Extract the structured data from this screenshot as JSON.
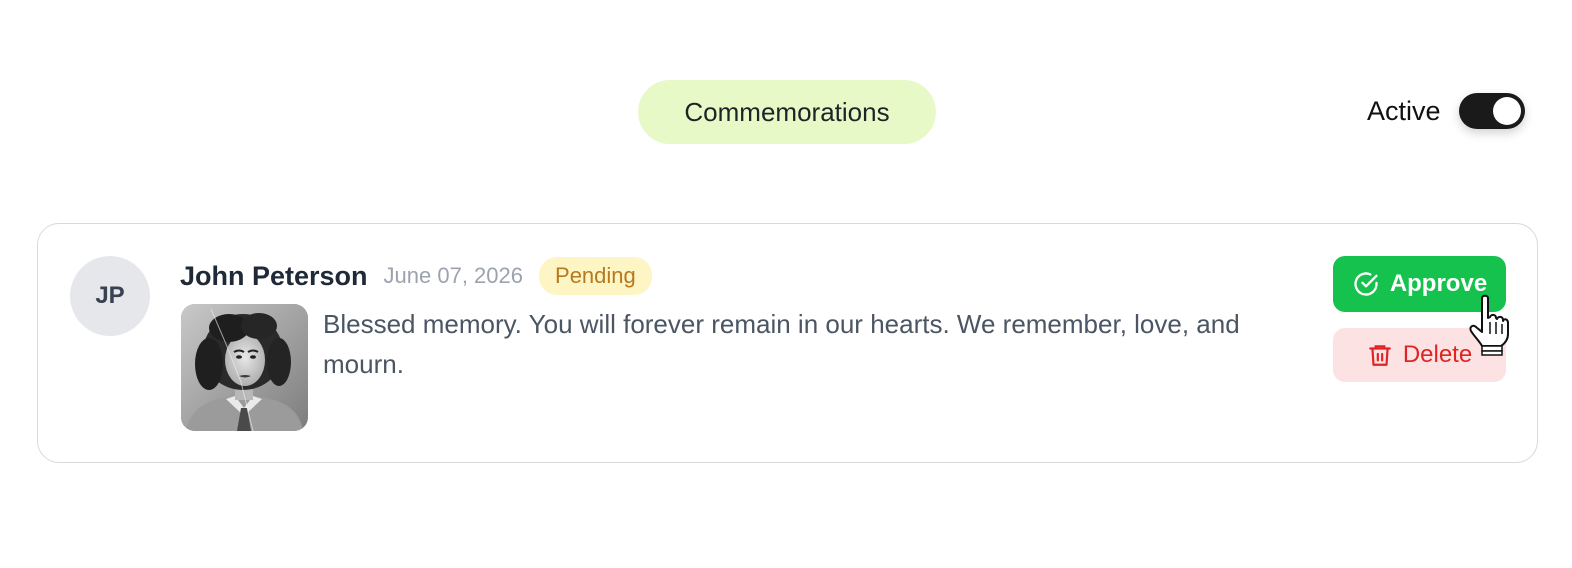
{
  "header": {
    "title": "Commemorations",
    "active_label": "Active",
    "active_on": true
  },
  "card": {
    "avatar_initials": "JP",
    "author": "John Peterson",
    "date": "June 07, 2026",
    "status": "Pending",
    "message": "Blessed memory. You will forever remain in our hearts. We remember, love, and mourn.",
    "photo_icon": "portrait-photo",
    "actions": {
      "approve_label": "Approve",
      "approve_icon": "check-circle-icon",
      "delete_label": "Delete",
      "delete_icon": "trash-icon"
    }
  },
  "colors": {
    "approve": "#14c24d",
    "delete_bg": "#fde2e3",
    "delete_text": "#e02424",
    "pending_bg": "#fdf5c4",
    "pending_text": "#b7791f",
    "header_pill": "#e6f9c6"
  }
}
